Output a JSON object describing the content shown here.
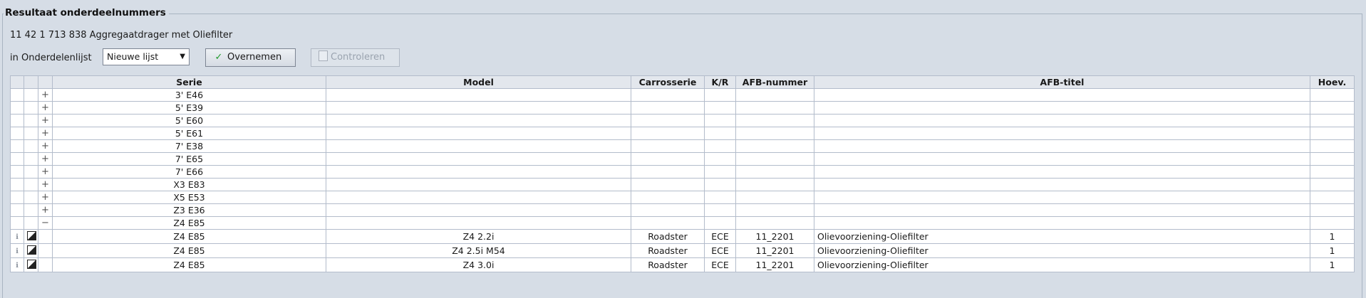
{
  "panel": {
    "title": "Resultaat onderdeelnummers"
  },
  "part": {
    "description": "11 42 1 713 838 Aggregaatdrager met Oliefilter"
  },
  "list": {
    "label": "in Onderdelenlijst",
    "selected": "Nieuwe lijst"
  },
  "buttons": {
    "accept_label": "Overnemen",
    "check_label": "Controleren"
  },
  "table": {
    "headers": {
      "serie": "Serie",
      "model": "Model",
      "body": "Carrosserie",
      "kr": "K/R",
      "afb_no": "AFB-nummer",
      "afb_title": "AFB-titel",
      "qty": "Hoev."
    },
    "groups": [
      {
        "toggle": "+",
        "serie": "3' E46"
      },
      {
        "toggle": "+",
        "serie": "5' E39"
      },
      {
        "toggle": "+",
        "serie": "5' E60"
      },
      {
        "toggle": "+",
        "serie": "5' E61"
      },
      {
        "toggle": "+",
        "serie": "7' E38"
      },
      {
        "toggle": "+",
        "serie": "7' E65"
      },
      {
        "toggle": "+",
        "serie": "7' E66"
      },
      {
        "toggle": "+",
        "serie": "X3 E83"
      },
      {
        "toggle": "+",
        "serie": "X5 E53"
      },
      {
        "toggle": "+",
        "serie": "Z3 E36"
      },
      {
        "toggle": "−",
        "serie": "Z4 E85"
      }
    ],
    "rows": [
      {
        "serie": "Z4 E85",
        "model": "Z4 2.2i",
        "body": "Roadster",
        "kr": "ECE",
        "afb_no": "11_2201",
        "afb_title": "Olievoorziening-Oliefilter",
        "qty": "1"
      },
      {
        "serie": "Z4 E85",
        "model": "Z4 2.5i M54",
        "body": "Roadster",
        "kr": "ECE",
        "afb_no": "11_2201",
        "afb_title": "Olievoorziening-Oliefilter",
        "qty": "1"
      },
      {
        "serie": "Z4 E85",
        "model": "Z4 3.0i",
        "body": "Roadster",
        "kr": "ECE",
        "afb_no": "11_2201",
        "afb_title": "Olievoorziening-Oliefilter",
        "qty": "1"
      }
    ]
  }
}
